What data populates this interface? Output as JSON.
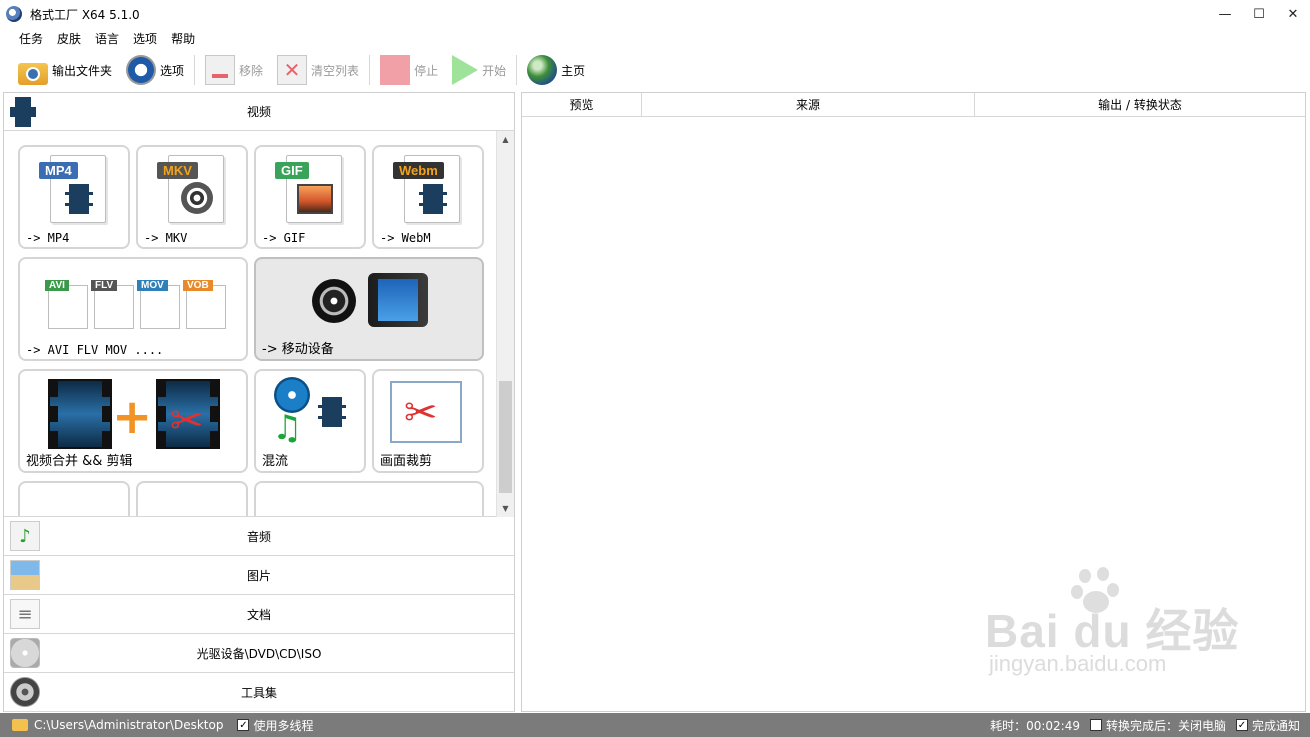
{
  "window": {
    "title": "格式工厂 X64 5.1.0",
    "minimize": "—",
    "maximize": "☐",
    "close": "✕"
  },
  "menu": [
    "任务",
    "皮肤",
    "语言",
    "选项",
    "帮助"
  ],
  "toolbar": {
    "output_folder": "输出文件夹",
    "options": "选项",
    "remove": "移除",
    "clear_list": "清空列表",
    "stop": "停止",
    "start": "开始",
    "home": "主页"
  },
  "categories": {
    "video": "视频",
    "audio": "音频",
    "picture": "图片",
    "document": "文档",
    "disc": "光驱设备\\DVD\\CD\\ISO",
    "tools": "工具集"
  },
  "video_tiles": {
    "mp4": {
      "label": "-> MP4",
      "tag": "MP4"
    },
    "mkv": {
      "label": "-> MKV",
      "tag": "MKV"
    },
    "gif": {
      "label": "-> GIF",
      "tag": "GIF"
    },
    "webm": {
      "label": "-> WebM",
      "tag": "Webm"
    },
    "multi": {
      "label": "-> AVI FLV MOV ....",
      "tags": [
        "AVI",
        "FLV",
        "MOV",
        "VOB"
      ]
    },
    "mobile": {
      "label": "-> 移动设备"
    },
    "merge": {
      "label": "视频合并 && 剪辑"
    },
    "mux": {
      "label": "混流"
    },
    "crop": {
      "label": "画面裁剪"
    }
  },
  "file_list": {
    "columns": [
      "预览",
      "来源",
      "输出 / 转换状态"
    ]
  },
  "watermark": {
    "main": "Bai du 经验",
    "sub": "jingyan.baidu.com"
  },
  "statusbar": {
    "path": "C:\\Users\\Administrator\\Desktop",
    "multithread": "使用多线程",
    "elapsed": "耗时：00:02:49",
    "after_complete": "转换完成后：关闭电脑",
    "notify": "完成通知"
  },
  "colors": {
    "mp4": "#3b6db3",
    "mkv": "#555555",
    "gif": "#3aa35a",
    "webm": "#333333",
    "webm_text": "#f2a31b",
    "avi": "#3a9a4a",
    "flv": "#555555",
    "mov": "#2f7fb8",
    "vob": "#e88a2b",
    "statusbar": "#7b7b7b"
  }
}
